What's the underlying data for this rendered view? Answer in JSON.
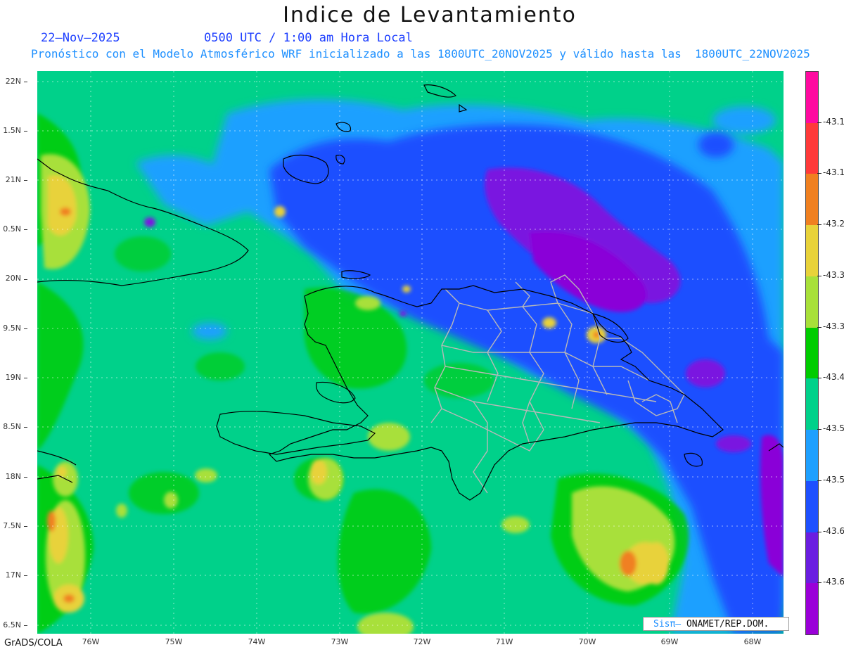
{
  "header": {
    "title": "Indice de Levantamiento",
    "date": "22—Nov—2025",
    "time": "0500 UTC / 1:00 am Hora Local",
    "description": "Pronóstico con el Modelo Atmosférico WRF inicializado a las 1800UTC_20NOV2025 y válido hasta las  1800UTC_22NOV2025"
  },
  "map": {
    "lat_labels": [
      "22N",
      "1.5N",
      "21N",
      "0.5N",
      "20N",
      "9.5N",
      "19N",
      "8.5N",
      "18N",
      "7.5N",
      "17N",
      "6.5N"
    ],
    "lon_labels": [
      "76W",
      "75W",
      "74W",
      "73W",
      "72W",
      "71W",
      "70W",
      "69W",
      "68W"
    ],
    "base_color": "#00d18a"
  },
  "colorbar": {
    "colors": [
      "#ff0aa0",
      "#ff3a3a",
      "#f08020",
      "#e8d23a",
      "#a8e03a",
      "#00cc00",
      "#00d18a",
      "#1ea0ff",
      "#1e50ff",
      "#6a1ee0",
      "#9a00d8"
    ],
    "labels": [
      "-43.1",
      "-43.1",
      "-43.2",
      "-43.3",
      "-43.3",
      "-43.4",
      "-43.5",
      "-43.5",
      "-43.6",
      "-43.6"
    ]
  },
  "credit": {
    "logo": "Sisπ—",
    "org": " ONAMET/REP.DOM."
  },
  "footer": {
    "software": "GrADS/COLA"
  }
}
